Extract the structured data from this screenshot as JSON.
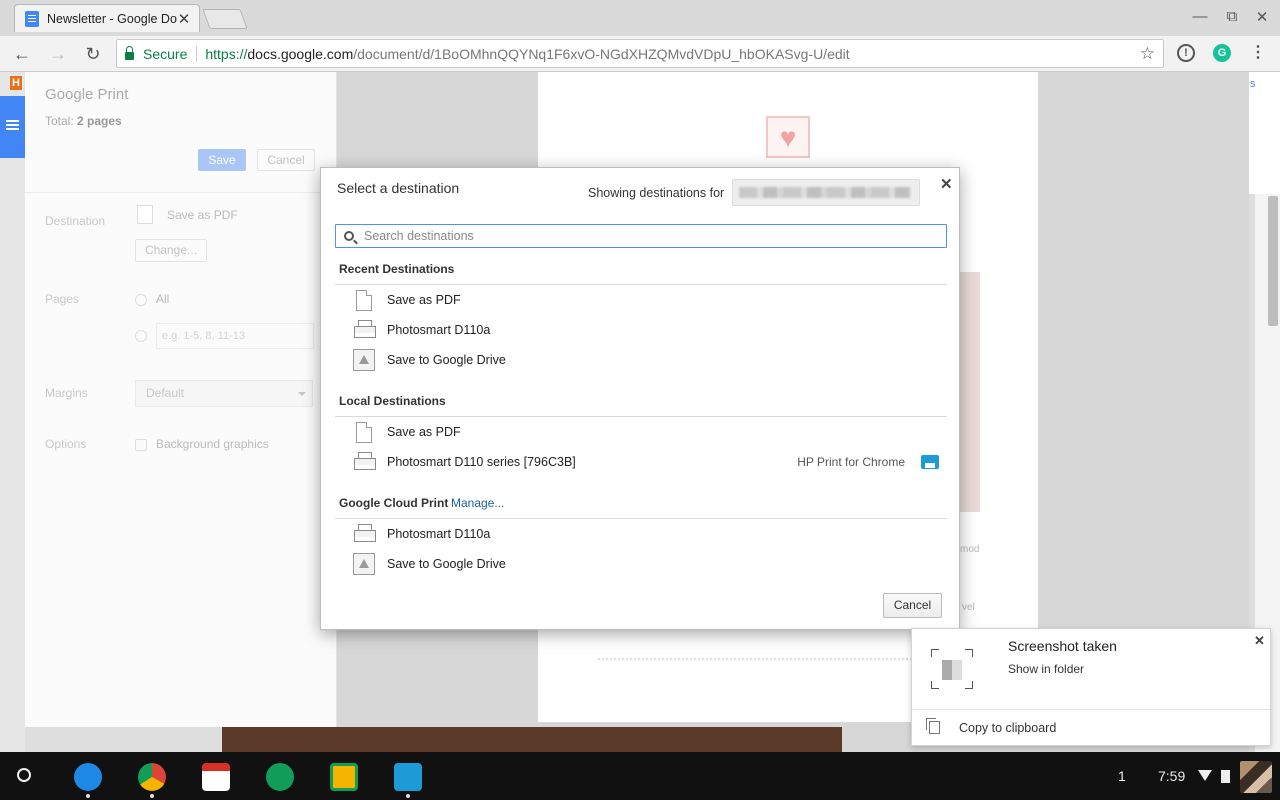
{
  "browser": {
    "tab_title": "Newsletter - Google Docs",
    "tab_close": "✕",
    "secure_label": "Secure",
    "url_proto": "https://",
    "url_host": "docs.google.com",
    "url_path": "/document/d/1BoOMhnQQYNq1F6xvO-NGdXHZQMvdVDpU_hbOKASvg-U/edit",
    "nav_back": "←",
    "nav_forward": "→",
    "nav_reload": "↻",
    "bookmark_star": "☆",
    "window_minimize": "—",
    "window_maximize": "⧉",
    "window_close": "✕",
    "ext_1": "!",
    "ext_2": "G",
    "menu": "⋮"
  },
  "print_panel": {
    "title": "Google Print",
    "total_prefix": "Total: ",
    "total_value": "2 pages",
    "save": "Save",
    "cancel": "Cancel",
    "destination_label": "Destination",
    "destination_value": "Save as PDF",
    "change_button": "Change...",
    "pages_label": "Pages",
    "pages_all": "All",
    "pages_placeholder": "e.g. 1-5, 8, 11-13",
    "margins_label": "Margins",
    "margins_value": "Default",
    "options_label": "Options",
    "background_graphics": "Background graphics"
  },
  "docs": {
    "h_badge": "H",
    "preview_fragment_1": "mod",
    "preview_fragment_2": "vel"
  },
  "dialog": {
    "title": "Select a destination",
    "showing_for": "Showing destinations for",
    "close": "✕",
    "search_placeholder": "Search destinations",
    "recent": {
      "heading": "Recent Destinations",
      "items": [
        {
          "label": "Save as PDF",
          "icon": "pdf-file-icon"
        },
        {
          "label": "Photosmart D110a",
          "icon": "printer-icon"
        },
        {
          "label": "Save to Google Drive",
          "icon": "google-drive-icon"
        }
      ]
    },
    "local": {
      "heading": "Local Destinations",
      "items": [
        {
          "label": "Save as PDF",
          "icon": "pdf-file-icon"
        },
        {
          "label": "Photosmart D110 series [796C3B]",
          "icon": "printer-icon",
          "provider": "HP Print for Chrome"
        }
      ]
    },
    "cloud": {
      "heading": "Google Cloud Print",
      "manage": "Manage...",
      "items": [
        {
          "label": "Photosmart D110a",
          "icon": "printer-icon"
        },
        {
          "label": "Save to Google Drive",
          "icon": "google-drive-icon"
        }
      ]
    },
    "cancel": "Cancel"
  },
  "notification": {
    "title": "Screenshot taken",
    "subtitle": "Show in folder",
    "copy": "Copy to clipboard",
    "close": "✕"
  },
  "shelf": {
    "apps": [
      "files-icon",
      "chrome-icon",
      "gmail-icon",
      "hangouts-icon",
      "slides-icon",
      "hp-print-icon"
    ],
    "tray_count": "1",
    "time": "7:59"
  },
  "colors": {
    "accent": "#4285f4",
    "secure_green": "#0b8043",
    "link_blue": "#1a5dab",
    "shelf": "#111111"
  }
}
